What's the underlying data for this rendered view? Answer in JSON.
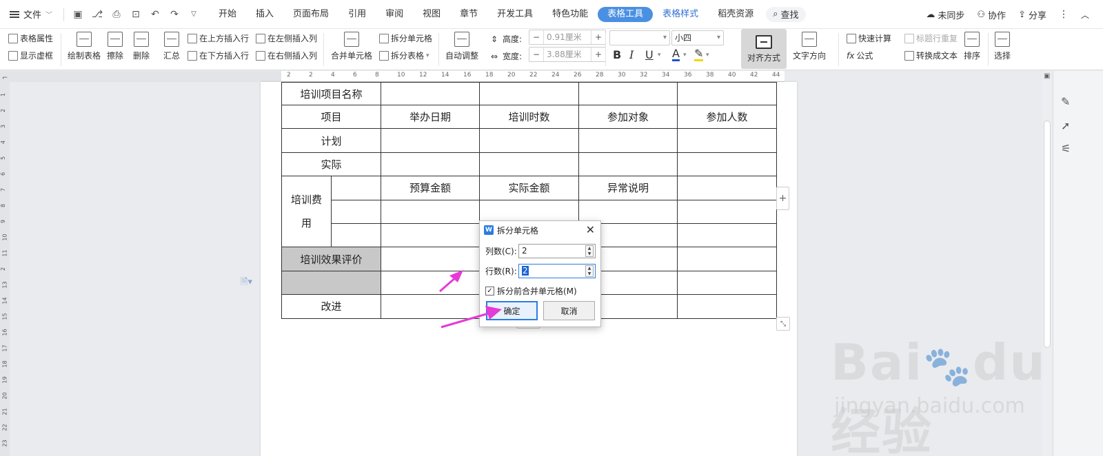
{
  "menubar": {
    "file_label": "文件",
    "tabs": [
      {
        "label": "开始"
      },
      {
        "label": "插入"
      },
      {
        "label": "页面布局"
      },
      {
        "label": "引用"
      },
      {
        "label": "审阅"
      },
      {
        "label": "视图"
      },
      {
        "label": "章节"
      },
      {
        "label": "开发工具"
      },
      {
        "label": "特色功能"
      },
      {
        "label": "表格工具"
      },
      {
        "label": "表格样式"
      },
      {
        "label": "稻壳资源"
      }
    ],
    "search_label": "查找",
    "right": {
      "sync": "未同步",
      "collab": "协作",
      "share": "分享"
    }
  },
  "ribbon": {
    "table_props": "表格属性",
    "show_grid": "显示虚框",
    "draw_table": "绘制表格",
    "erase": "擦除",
    "delete": "删除",
    "summary": "汇总",
    "insert_above": "在上方插入行",
    "insert_below": "在下方插入行",
    "insert_left": "在左侧插入列",
    "insert_right": "在右侧插入列",
    "merge_cells": "合并单元格",
    "split_cells": "拆分单元格",
    "split_table": "拆分表格",
    "auto_fit": "自动调整",
    "height_label": "高度:",
    "height_value": "0.91厘米",
    "width_label": "宽度:",
    "width_value": "3.88厘米",
    "font_name": "",
    "font_size": "小四",
    "align": "对齐方式",
    "text_dir": "文字方向",
    "quick_calc": "快速计算",
    "repeat_header": "标题行重复",
    "formula": "公式",
    "to_text": "转换成文本",
    "sort": "排序",
    "select": "选择"
  },
  "ruler": {
    "h_ticks": [
      "2",
      "2",
      "4",
      "6",
      "8",
      "10",
      "12",
      "14",
      "16",
      "18",
      "20",
      "22",
      "24",
      "26",
      "28",
      "30",
      "32",
      "34",
      "36",
      "38",
      "40",
      "42",
      "44"
    ],
    "v_ticks": [
      "1",
      "2",
      "3",
      "4",
      "5",
      "6",
      "7",
      "8",
      "9",
      "10",
      "11",
      "2",
      "13",
      "14",
      "15",
      "16",
      "17",
      "18",
      "19",
      "20",
      "21",
      "22",
      "23"
    ]
  },
  "table": {
    "row1": [
      "培训项目名称"
    ],
    "headers": [
      "项目",
      "举办日期",
      "培训时数",
      "参加对象",
      "参加人数"
    ],
    "plan": "计划",
    "actual": "实际",
    "fee": "培训费",
    "fee2": "用",
    "fee_headers": [
      "预算金额",
      "实际金额",
      "异常说明"
    ],
    "eval": "培训效果评价",
    "improve": "改进"
  },
  "dialog": {
    "title": "拆分单元格",
    "cols_label": "列数(C):",
    "cols_value": "2",
    "rows_label": "行数(R):",
    "rows_value": "2",
    "merge_label": "拆分前合并单元格(M)",
    "ok": "确定",
    "cancel": "取消"
  },
  "watermark": {
    "logo": "Bai du 经验",
    "url": "jingyan.baidu.com"
  },
  "colors": {
    "accent": "#4a90e2",
    "arrow": "#e63ad8"
  }
}
